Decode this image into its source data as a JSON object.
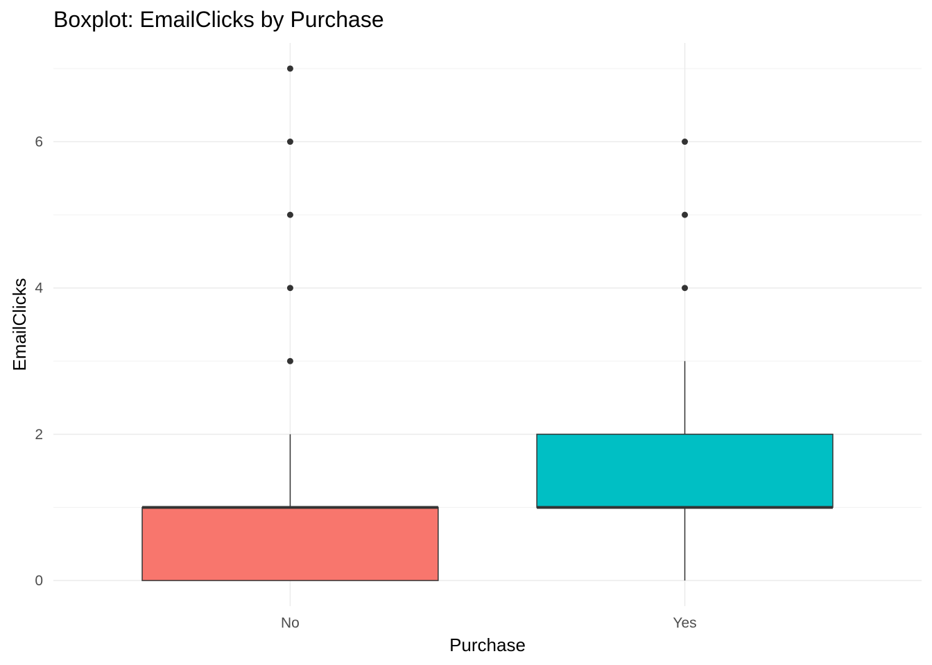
{
  "chart_data": {
    "type": "boxplot",
    "title": "Boxplot: EmailClicks by Purchase",
    "xlabel": "Purchase",
    "ylabel": "EmailClicks",
    "ylim": [
      -0.35,
      7.35
    ],
    "yticks": [
      0,
      2,
      4,
      6
    ],
    "grid": true,
    "legend": "none",
    "categories": [
      "No",
      "Yes"
    ],
    "boxes": [
      {
        "category": "No",
        "min": 0,
        "q1": 0,
        "median": 1,
        "q3": 1,
        "max": 2,
        "outliers": [
          3,
          4,
          5,
          6,
          7
        ],
        "color": "#F8766D"
      },
      {
        "category": "Yes",
        "min": 0,
        "q1": 1,
        "median": 1,
        "q3": 2,
        "max": 3,
        "outliers": [
          4,
          5,
          6
        ],
        "color": "#00BFC4"
      }
    ]
  }
}
